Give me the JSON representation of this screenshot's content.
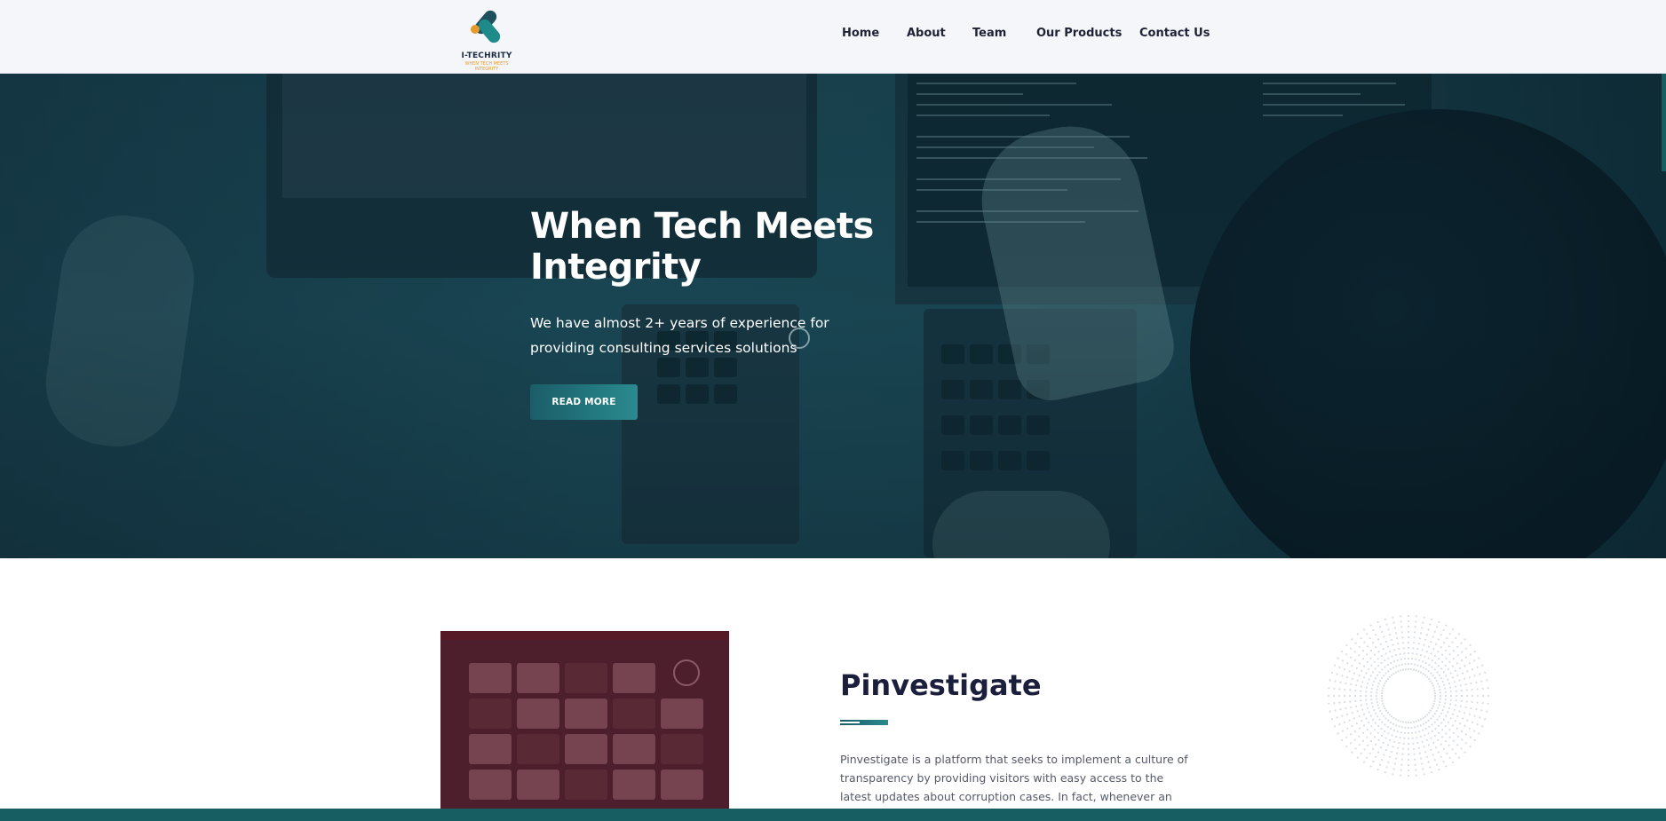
{
  "header": {
    "logo_text": "I-TECHRITY",
    "logo_tagline": "WHEN TECH MEETS INTEGRITY",
    "nav": [
      {
        "label": "Home"
      },
      {
        "label": "About"
      },
      {
        "label": "Team"
      },
      {
        "label": "Our Products"
      },
      {
        "label": "Contact Us"
      }
    ]
  },
  "hero": {
    "title": "When Tech Meets Integrity",
    "subtitle": "We have almost 2+ years of experience for providing consulting services solutions",
    "button_label": "READ MORE"
  },
  "product": {
    "title": "Pinvestigate",
    "description": "Pinvestigate is a platform that seeks to implement a culture of transparency by providing visitors with easy access to the latest updates about corruption cases. In fact, whenever an issue that"
  },
  "colors": {
    "accent": "#1a5d68",
    "accent_light": "#2a8a8f",
    "heading": "#1b1f3b",
    "logo_orange": "#e69a2c",
    "header_bg": "#f5f6fa"
  }
}
